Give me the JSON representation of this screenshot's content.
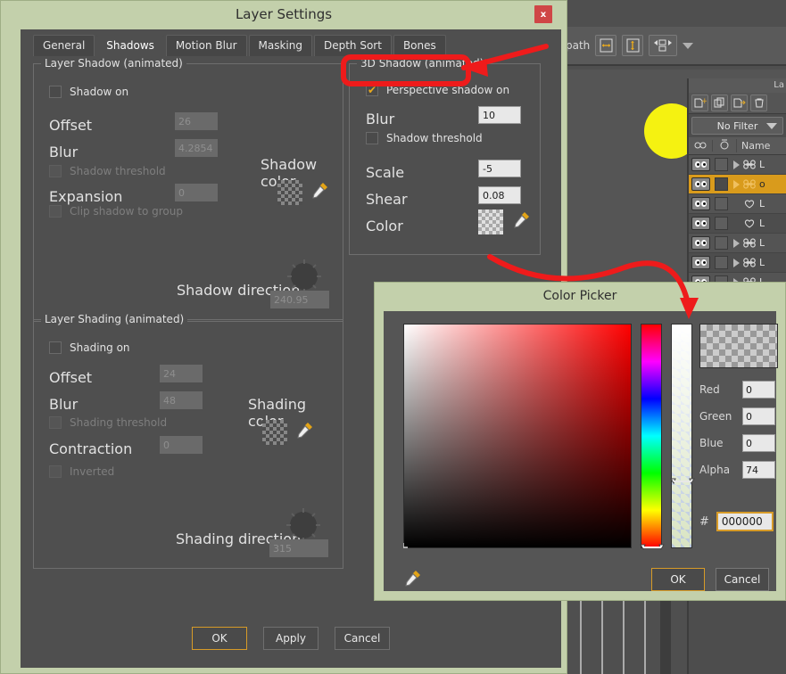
{
  "app": {
    "toolbar": {
      "path_label": "path",
      "icons": [
        "page-width-icon",
        "page-height-icon",
        "resize-icon",
        "chevron-down-icon"
      ]
    },
    "layers_panel": {
      "title": "La",
      "tool_icons": [
        "new-layer-icon",
        "duplicate-layer-icon",
        "new-group-icon",
        "delete-layer-icon"
      ],
      "filter_value": "No Filter",
      "columns": {
        "visibility": "visibility-icon",
        "lock": "timer-icon",
        "name": "Name"
      },
      "rows": [
        {
          "name": "L",
          "type": "bone",
          "expandable": true,
          "selected": false
        },
        {
          "name": "o",
          "type": "bone",
          "expandable": true,
          "selected": true
        },
        {
          "name": "L",
          "type": "shape",
          "expandable": false,
          "selected": false
        },
        {
          "name": "L",
          "type": "shape",
          "expandable": false,
          "selected": false
        },
        {
          "name": "L",
          "type": "bone",
          "expandable": true,
          "selected": false
        },
        {
          "name": "L",
          "type": "bone",
          "expandable": true,
          "selected": false
        },
        {
          "name": "L",
          "type": "bone",
          "expandable": true,
          "selected": false
        }
      ]
    }
  },
  "layer_settings": {
    "title": "Layer Settings",
    "close_label": "x",
    "tabs": [
      {
        "label": "General",
        "active": false
      },
      {
        "label": "Shadows",
        "active": true
      },
      {
        "label": "Motion Blur",
        "active": false
      },
      {
        "label": "Masking",
        "active": false
      },
      {
        "label": "Depth Sort",
        "active": false
      },
      {
        "label": "Bones",
        "active": false
      }
    ],
    "layer_shadow": {
      "legend": "Layer Shadow (animated)",
      "shadow_on_label": "Shadow on",
      "shadow_on_checked": false,
      "offset_label": "Offset",
      "offset_value": "26",
      "blur_label": "Blur",
      "blur_value": "4.2854",
      "threshold_label": "Shadow threshold",
      "threshold_checked": false,
      "expansion_label": "Expansion",
      "expansion_value": "0",
      "clip_label": "Clip shadow to group",
      "clip_checked": false,
      "color_label": "Shadow color",
      "direction_label": "Shadow direction",
      "direction_value": "240.95"
    },
    "layer_shading": {
      "legend": "Layer Shading (animated)",
      "shading_on_label": "Shading on",
      "shading_on_checked": false,
      "offset_label": "Offset",
      "offset_value": "24",
      "blur_label": "Blur",
      "blur_value": "48",
      "threshold_label": "Shading threshold",
      "threshold_checked": false,
      "contraction_label": "Contraction",
      "contraction_value": "0",
      "inverted_label": "Inverted",
      "inverted_checked": false,
      "color_label": "Shading color",
      "direction_label": "Shading direction",
      "direction_value": "315"
    },
    "shadow_3d": {
      "legend": "3D Shadow (animated)",
      "perspective_label": "Perspective shadow on",
      "perspective_checked": true,
      "blur_label": "Blur",
      "blur_value": "10",
      "threshold_label": "Shadow threshold",
      "threshold_checked": false,
      "scale_label": "Scale",
      "scale_value": "-5",
      "shear_label": "Shear",
      "shear_value": "0.08",
      "color_label": "Color"
    },
    "buttons": {
      "ok": "OK",
      "apply": "Apply",
      "cancel": "Cancel"
    }
  },
  "color_picker": {
    "title": "Color Picker",
    "red_label": "Red",
    "red_value": "0",
    "green_label": "Green",
    "green_value": "0",
    "blue_label": "Blue",
    "blue_value": "0",
    "alpha_label": "Alpha",
    "alpha_value": "74",
    "hash_label": "#",
    "hex_value": "000000",
    "eyedropper_icon": "eyedropper-icon",
    "ok_label": "OK",
    "cancel_label": "Cancel"
  },
  "annotations": {
    "color": "#ee1b1b",
    "highlight_target": "3D Shadow (animated)",
    "arrow_to_group": "arrow-pointing-to-3d-shadow-group",
    "arrow_to_picker": "arrow-from-color-swatch-to-color-picker"
  },
  "colors": {
    "dialog_titlebar": "#c3d0ab",
    "dialog_body": "#4f4f4f",
    "accent_orange": "#d79b28",
    "selection_orange": "#d99b1c",
    "annotation_red": "#ee1b1b",
    "canvas_blob": "#f5f211",
    "close_button": "#cf4646"
  }
}
